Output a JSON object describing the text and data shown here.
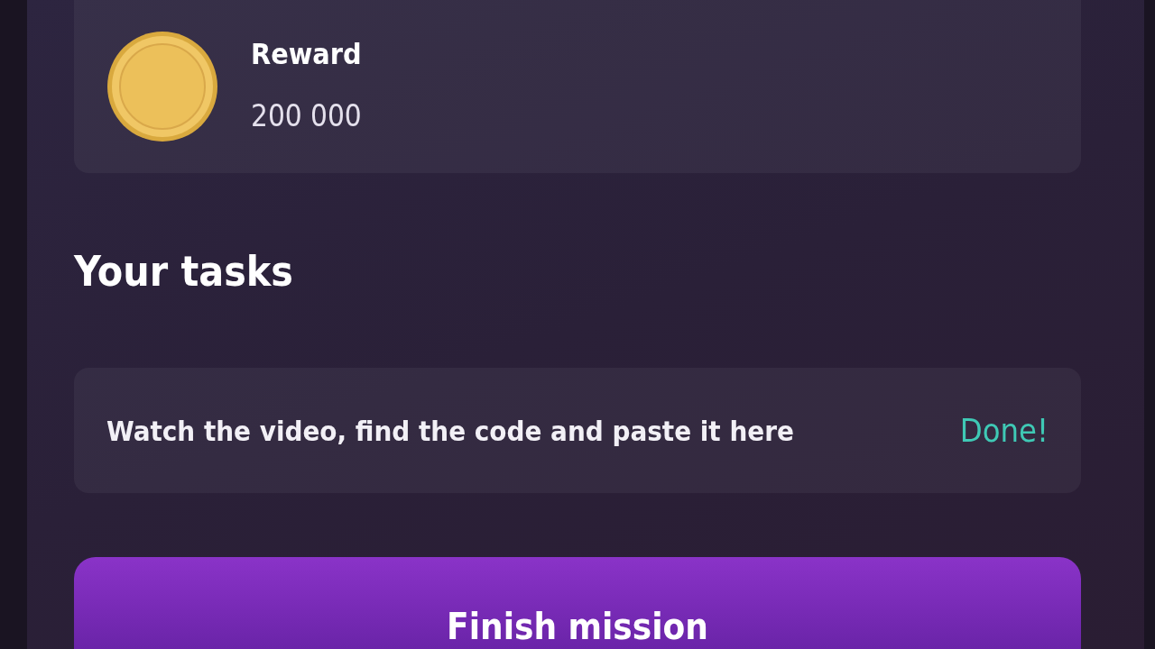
{
  "reward": {
    "label": "Reward",
    "amount": "200 000"
  },
  "tasks_heading": "Your tasks",
  "tasks": [
    {
      "text": "Watch the video, find the code and paste it here",
      "status": "Done!",
      "done": true
    }
  ],
  "finish_button": "Finish mission"
}
